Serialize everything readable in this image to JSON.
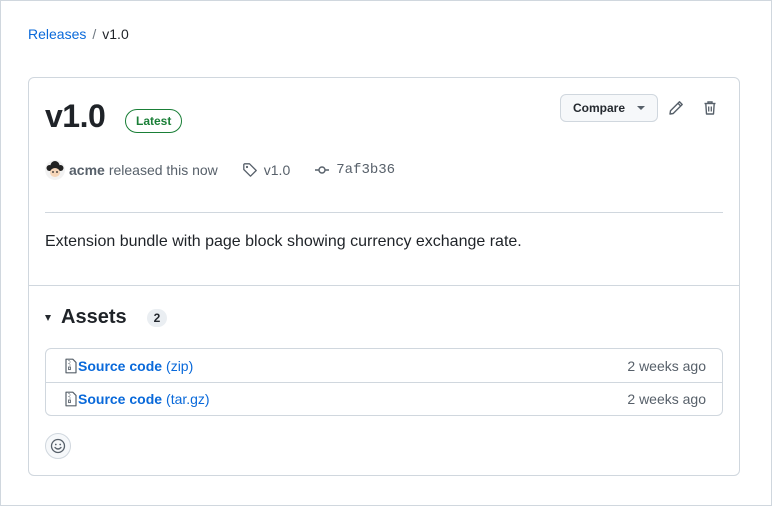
{
  "breadcrumb": {
    "root": "Releases",
    "separator": "/",
    "current": "v1.0"
  },
  "release": {
    "title": "v1.0",
    "badge": "Latest",
    "compare_label": "Compare",
    "author": "acme",
    "released_text": "released this now",
    "tag": "v1.0",
    "commit": "7af3b36",
    "description": "Extension bundle with page block showing currency exchange rate."
  },
  "assets": {
    "title": "Assets",
    "count": "2",
    "items": [
      {
        "name": "Source code",
        "ext": "(zip)",
        "time": "2 weeks ago"
      },
      {
        "name": "Source code",
        "ext": "(tar.gz)",
        "time": "2 weeks ago"
      }
    ]
  },
  "colors": {
    "link": "#0969da",
    "latest_green": "#1a7f37",
    "border": "#d0d7de",
    "muted": "#57606a"
  },
  "icons": [
    "pencil-icon",
    "trash-icon",
    "tag-icon",
    "commit-icon",
    "zip-file-icon",
    "smiley-icon"
  ]
}
